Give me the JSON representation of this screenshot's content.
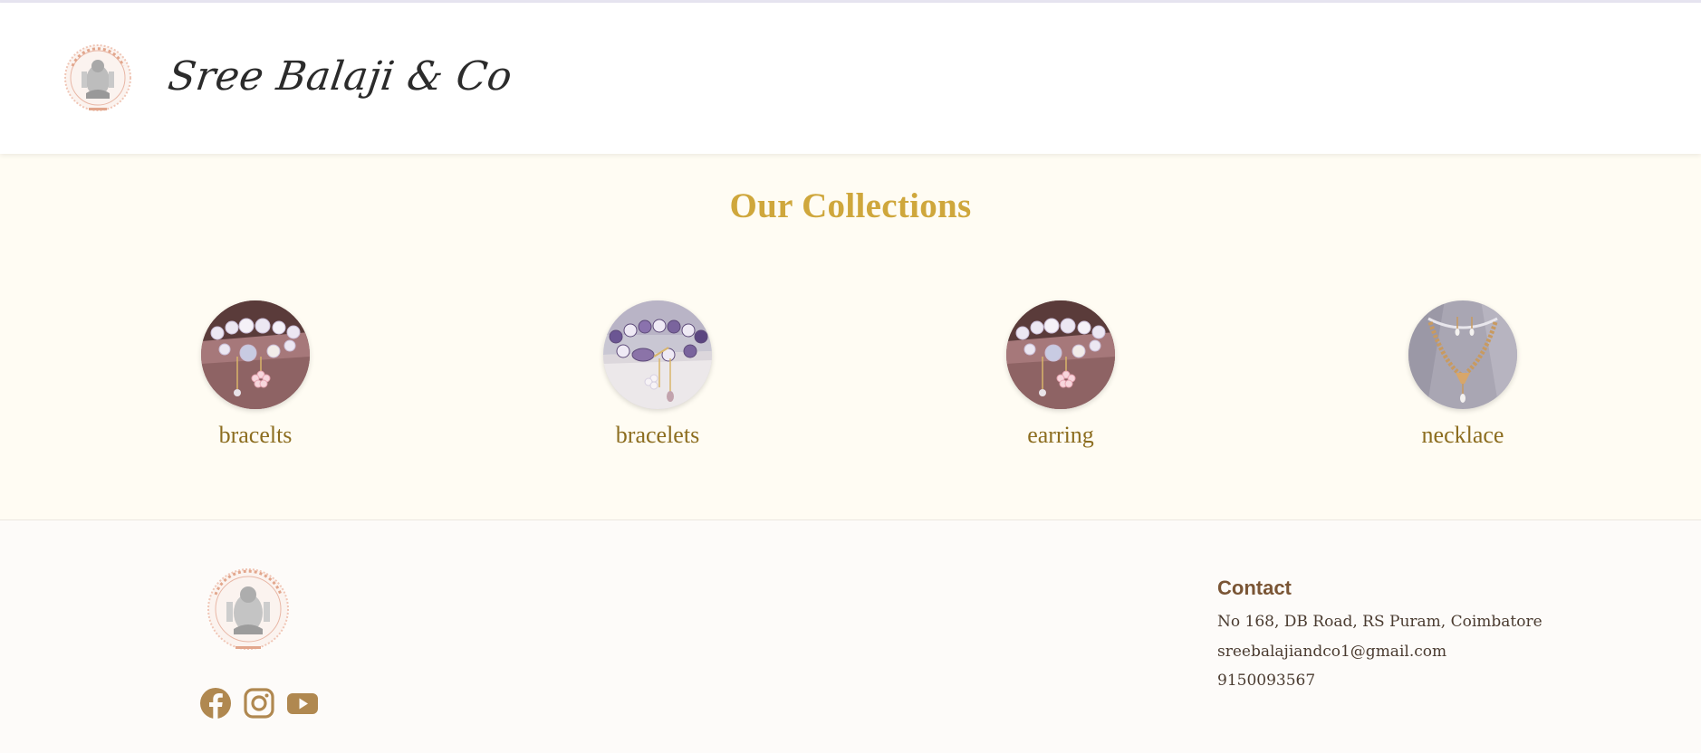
{
  "header": {
    "brand_name": "Sree Balaji & Co",
    "logo_icon": "temple-deity-seal-icon"
  },
  "collections": {
    "title": "Our Collections",
    "items": [
      {
        "label": "bracelts",
        "image": "bracelet-photo"
      },
      {
        "label": "bracelets",
        "image": "amethyst-bracelet-photo"
      },
      {
        "label": "earring",
        "image": "bracelet-photo"
      },
      {
        "label": "necklace",
        "image": "necklace-photo"
      }
    ]
  },
  "footer": {
    "logo_icon": "temple-deity-seal-icon",
    "social": [
      {
        "name": "facebook",
        "icon": "facebook-icon"
      },
      {
        "name": "instagram",
        "icon": "instagram-icon"
      },
      {
        "name": "youtube",
        "icon": "youtube-icon"
      }
    ],
    "contact": {
      "heading": "Contact",
      "address": "No 168, DB Road, RS Puram, Coimbatore",
      "email": "sreebalajiandco1@gmail.com",
      "phone": "9150093567"
    }
  },
  "colors": {
    "accent_gold": "#cfa73c",
    "label_gold": "#8c6d1f",
    "social_brown": "#b08850",
    "contact_heading": "#7a5535",
    "collections_bg": "#fffcf3"
  }
}
